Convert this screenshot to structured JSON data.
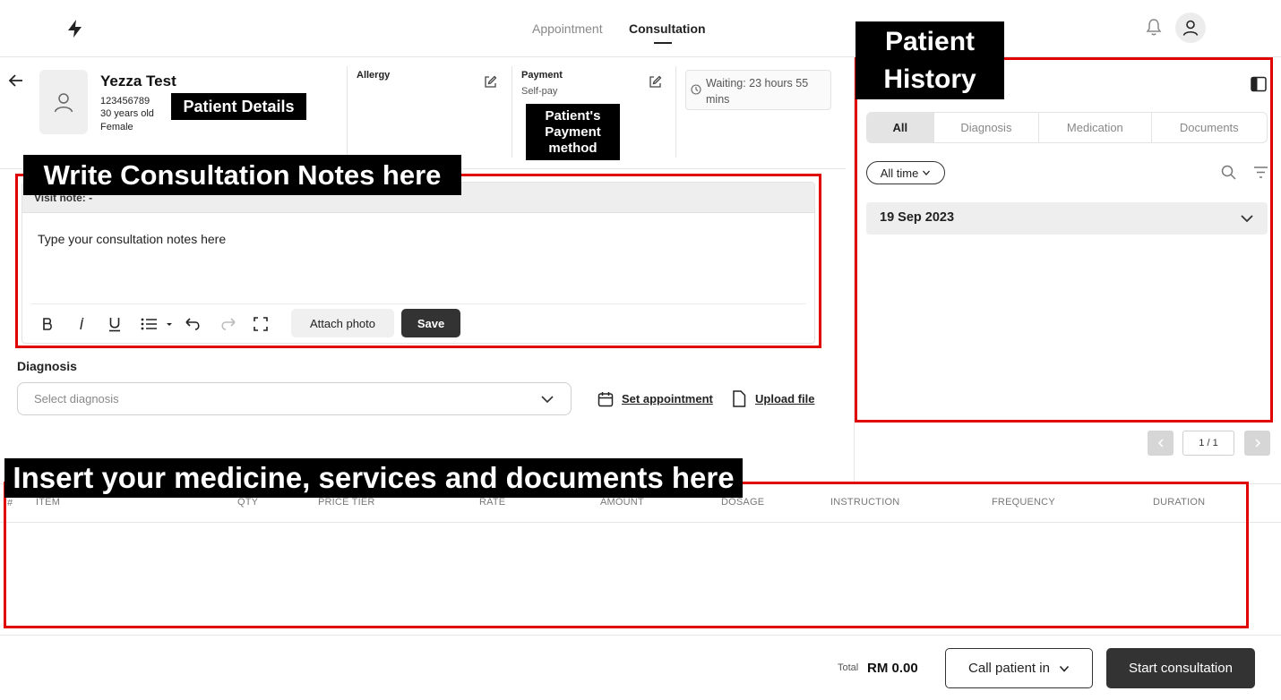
{
  "nav": {
    "appointment": "Appointment",
    "consultation": "Consultation"
  },
  "patient": {
    "name": "Yezza Test",
    "id": "123456789",
    "age": "30 years old",
    "sex": "Female"
  },
  "allergy": {
    "label": "Allergy"
  },
  "payment": {
    "label": "Payment",
    "value": "Self-pay"
  },
  "waiting": {
    "text": "Waiting: 23 hours 55 mins"
  },
  "editor": {
    "visit_note": "Visit note: -",
    "placeholder": "Type your consultation notes here",
    "attach_label": "Attach photo",
    "save_label": "Save"
  },
  "diagnosis": {
    "label": "Diagnosis",
    "placeholder": "Select diagnosis",
    "set_appointment": "Set appointment",
    "upload_file": "Upload file"
  },
  "items_table": {
    "index_header": "#",
    "columns": [
      "ITEM",
      "QTY",
      "PRICE TIER",
      "RATE",
      "AMOUNT",
      "DOSAGE",
      "INSTRUCTION",
      "FREQUENCY",
      "DURATION"
    ]
  },
  "footer": {
    "total_label": "Total",
    "total_value": "RM 0.00",
    "call_label": "Call patient in",
    "start_label": "Start consultation"
  },
  "history": {
    "tabs": [
      "All",
      "Diagnosis",
      "Medication",
      "Documents"
    ],
    "active_tab": "All",
    "time_filter": "All time",
    "date": "19 Sep 2023",
    "page_indicator": "1 / 1"
  },
  "annotations": {
    "patient_details": "Patient Details",
    "payment_method": "Patient's Payment method",
    "consultation_notes": "Write Consultation Notes here",
    "patient_history": "Patient History",
    "items": "Insert your medicine, services and documents here"
  },
  "colors": {
    "accent_dark": "#333333",
    "annotation_red": "#e00000",
    "annotation_tag": "#000000"
  }
}
